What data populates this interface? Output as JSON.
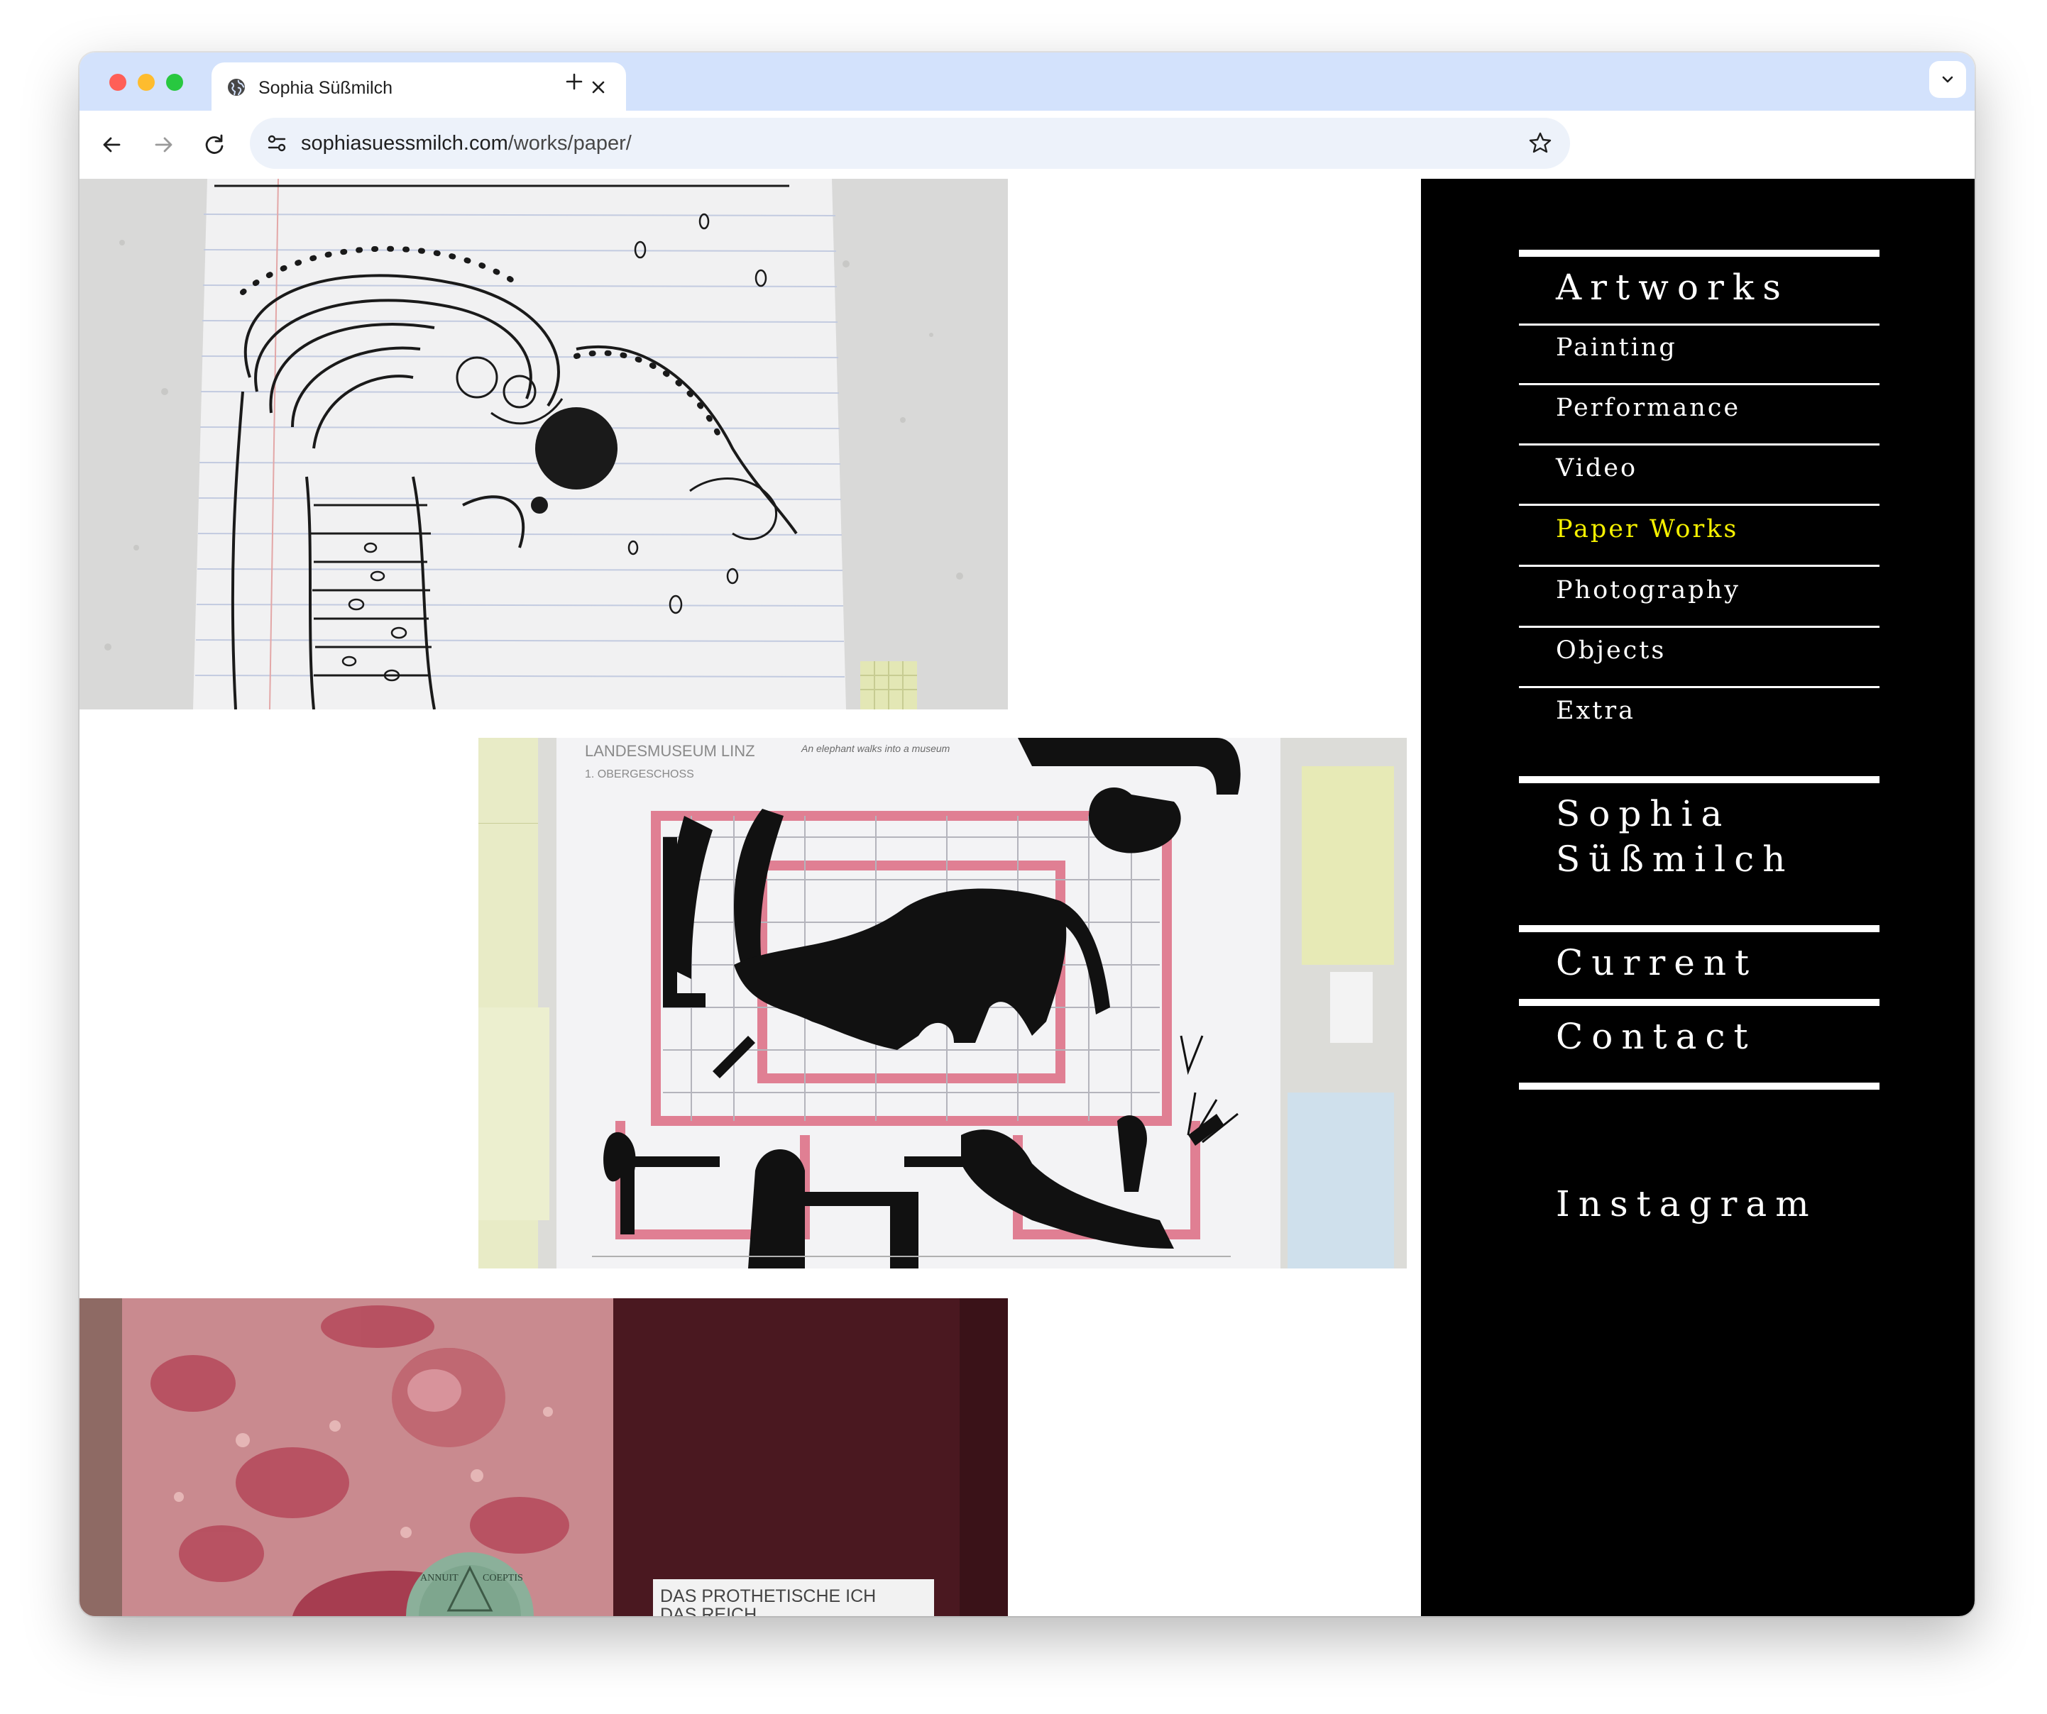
{
  "browser": {
    "tab_title": "Sophia Süßmilch",
    "url_domain": "sophiasuessmilch.com",
    "url_path": "/works/paper/"
  },
  "nav": {
    "section_heading": "Artworks",
    "items": [
      {
        "label": "Painting"
      },
      {
        "label": "Performance"
      },
      {
        "label": "Video"
      },
      {
        "label": "Paper Works"
      },
      {
        "label": "Photography"
      },
      {
        "label": "Objects"
      },
      {
        "label": "Extra"
      }
    ],
    "active_item": "Paper Works",
    "active_color": "#f5f000",
    "artist_name_line1": "Sophia",
    "artist_name_line2": "Süßmilch",
    "current_label": "Current",
    "contact_label": "Contact",
    "instagram_label": "Instagram"
  },
  "gallery": {
    "image_2": {
      "print_title": "LANDESMUSEUM LINZ",
      "print_subtitle": "1. OBERGESCHOSS",
      "handwriting": "An elephant walks into a museum"
    },
    "image_3": {
      "coin_text_left": "ANNUIT",
      "coin_text_right": "COEPTIS",
      "label_line1": "DAS PROTHETISCHE ICH",
      "label_line2": "DAS REICH"
    }
  },
  "colors": {
    "sidebar_bg": "#000000",
    "sidebar_text": "#ffffff",
    "tabbar_bg": "#d3e2fc",
    "omnibox_bg": "#edf2fa"
  }
}
